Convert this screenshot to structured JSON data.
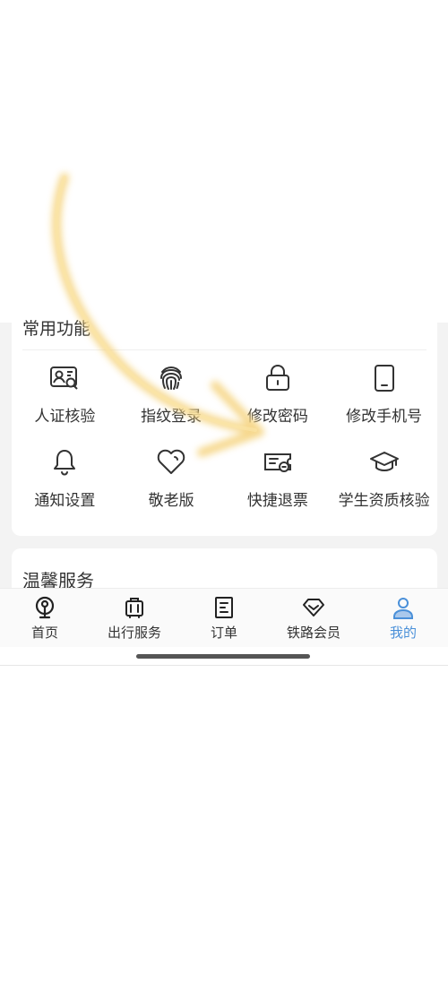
{
  "common_functions": {
    "title": "常用功能",
    "items": [
      {
        "label": "人证核验",
        "icon": "id-card-verify-icon"
      },
      {
        "label": "指纹登录",
        "icon": "fingerprint-icon"
      },
      {
        "label": "修改密码",
        "icon": "lock-icon"
      },
      {
        "label": "修改手机号",
        "icon": "phone-icon"
      },
      {
        "label": "通知设置",
        "icon": "bell-icon"
      },
      {
        "label": "敬老版",
        "icon": "heart-icon"
      },
      {
        "label": "快捷退票",
        "icon": "ticket-refund-icon"
      },
      {
        "label": "学生资质核验",
        "icon": "graduation-cap-icon"
      }
    ]
  },
  "warm_service": {
    "title": "温馨服务"
  },
  "tabbar": {
    "tabs": [
      {
        "label": "首页",
        "icon": "railway-logo-icon",
        "active": false
      },
      {
        "label": "出行服务",
        "icon": "luggage-icon",
        "active": false
      },
      {
        "label": "订单",
        "icon": "order-icon",
        "active": false
      },
      {
        "label": "铁路会员",
        "icon": "diamond-icon",
        "active": false
      },
      {
        "label": "我的",
        "icon": "user-icon",
        "active": true
      }
    ],
    "active_color": "#4a90d9",
    "text_color": "#333333"
  }
}
